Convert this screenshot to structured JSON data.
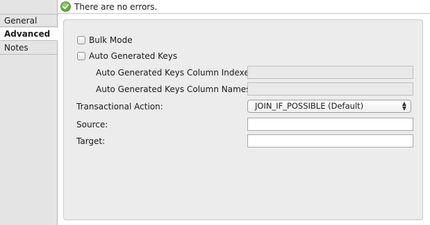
{
  "status": {
    "icon": "check-circle-icon",
    "text": "There are no errors.",
    "color": "#5aa13a"
  },
  "tabs": [
    {
      "label": "General",
      "active": false
    },
    {
      "label": "Advanced",
      "active": true
    },
    {
      "label": "Notes",
      "active": false
    }
  ],
  "form": {
    "bulk_mode": {
      "label": "Bulk Mode",
      "checked": false
    },
    "auto_generated_keys": {
      "label": "Auto Generated Keys",
      "checked": false
    },
    "keys_column_indexes": {
      "label": "Auto Generated Keys Column Indexes:",
      "value": ""
    },
    "keys_column_names": {
      "label": "Auto Generated Keys Column Names:",
      "value": ""
    },
    "transactional_action": {
      "label": "Transactional Action:",
      "value": "JOIN_IF_POSSIBLE (Default)"
    },
    "source": {
      "label": "Source:",
      "value": ""
    },
    "target": {
      "label": "Target:",
      "value": ""
    }
  }
}
